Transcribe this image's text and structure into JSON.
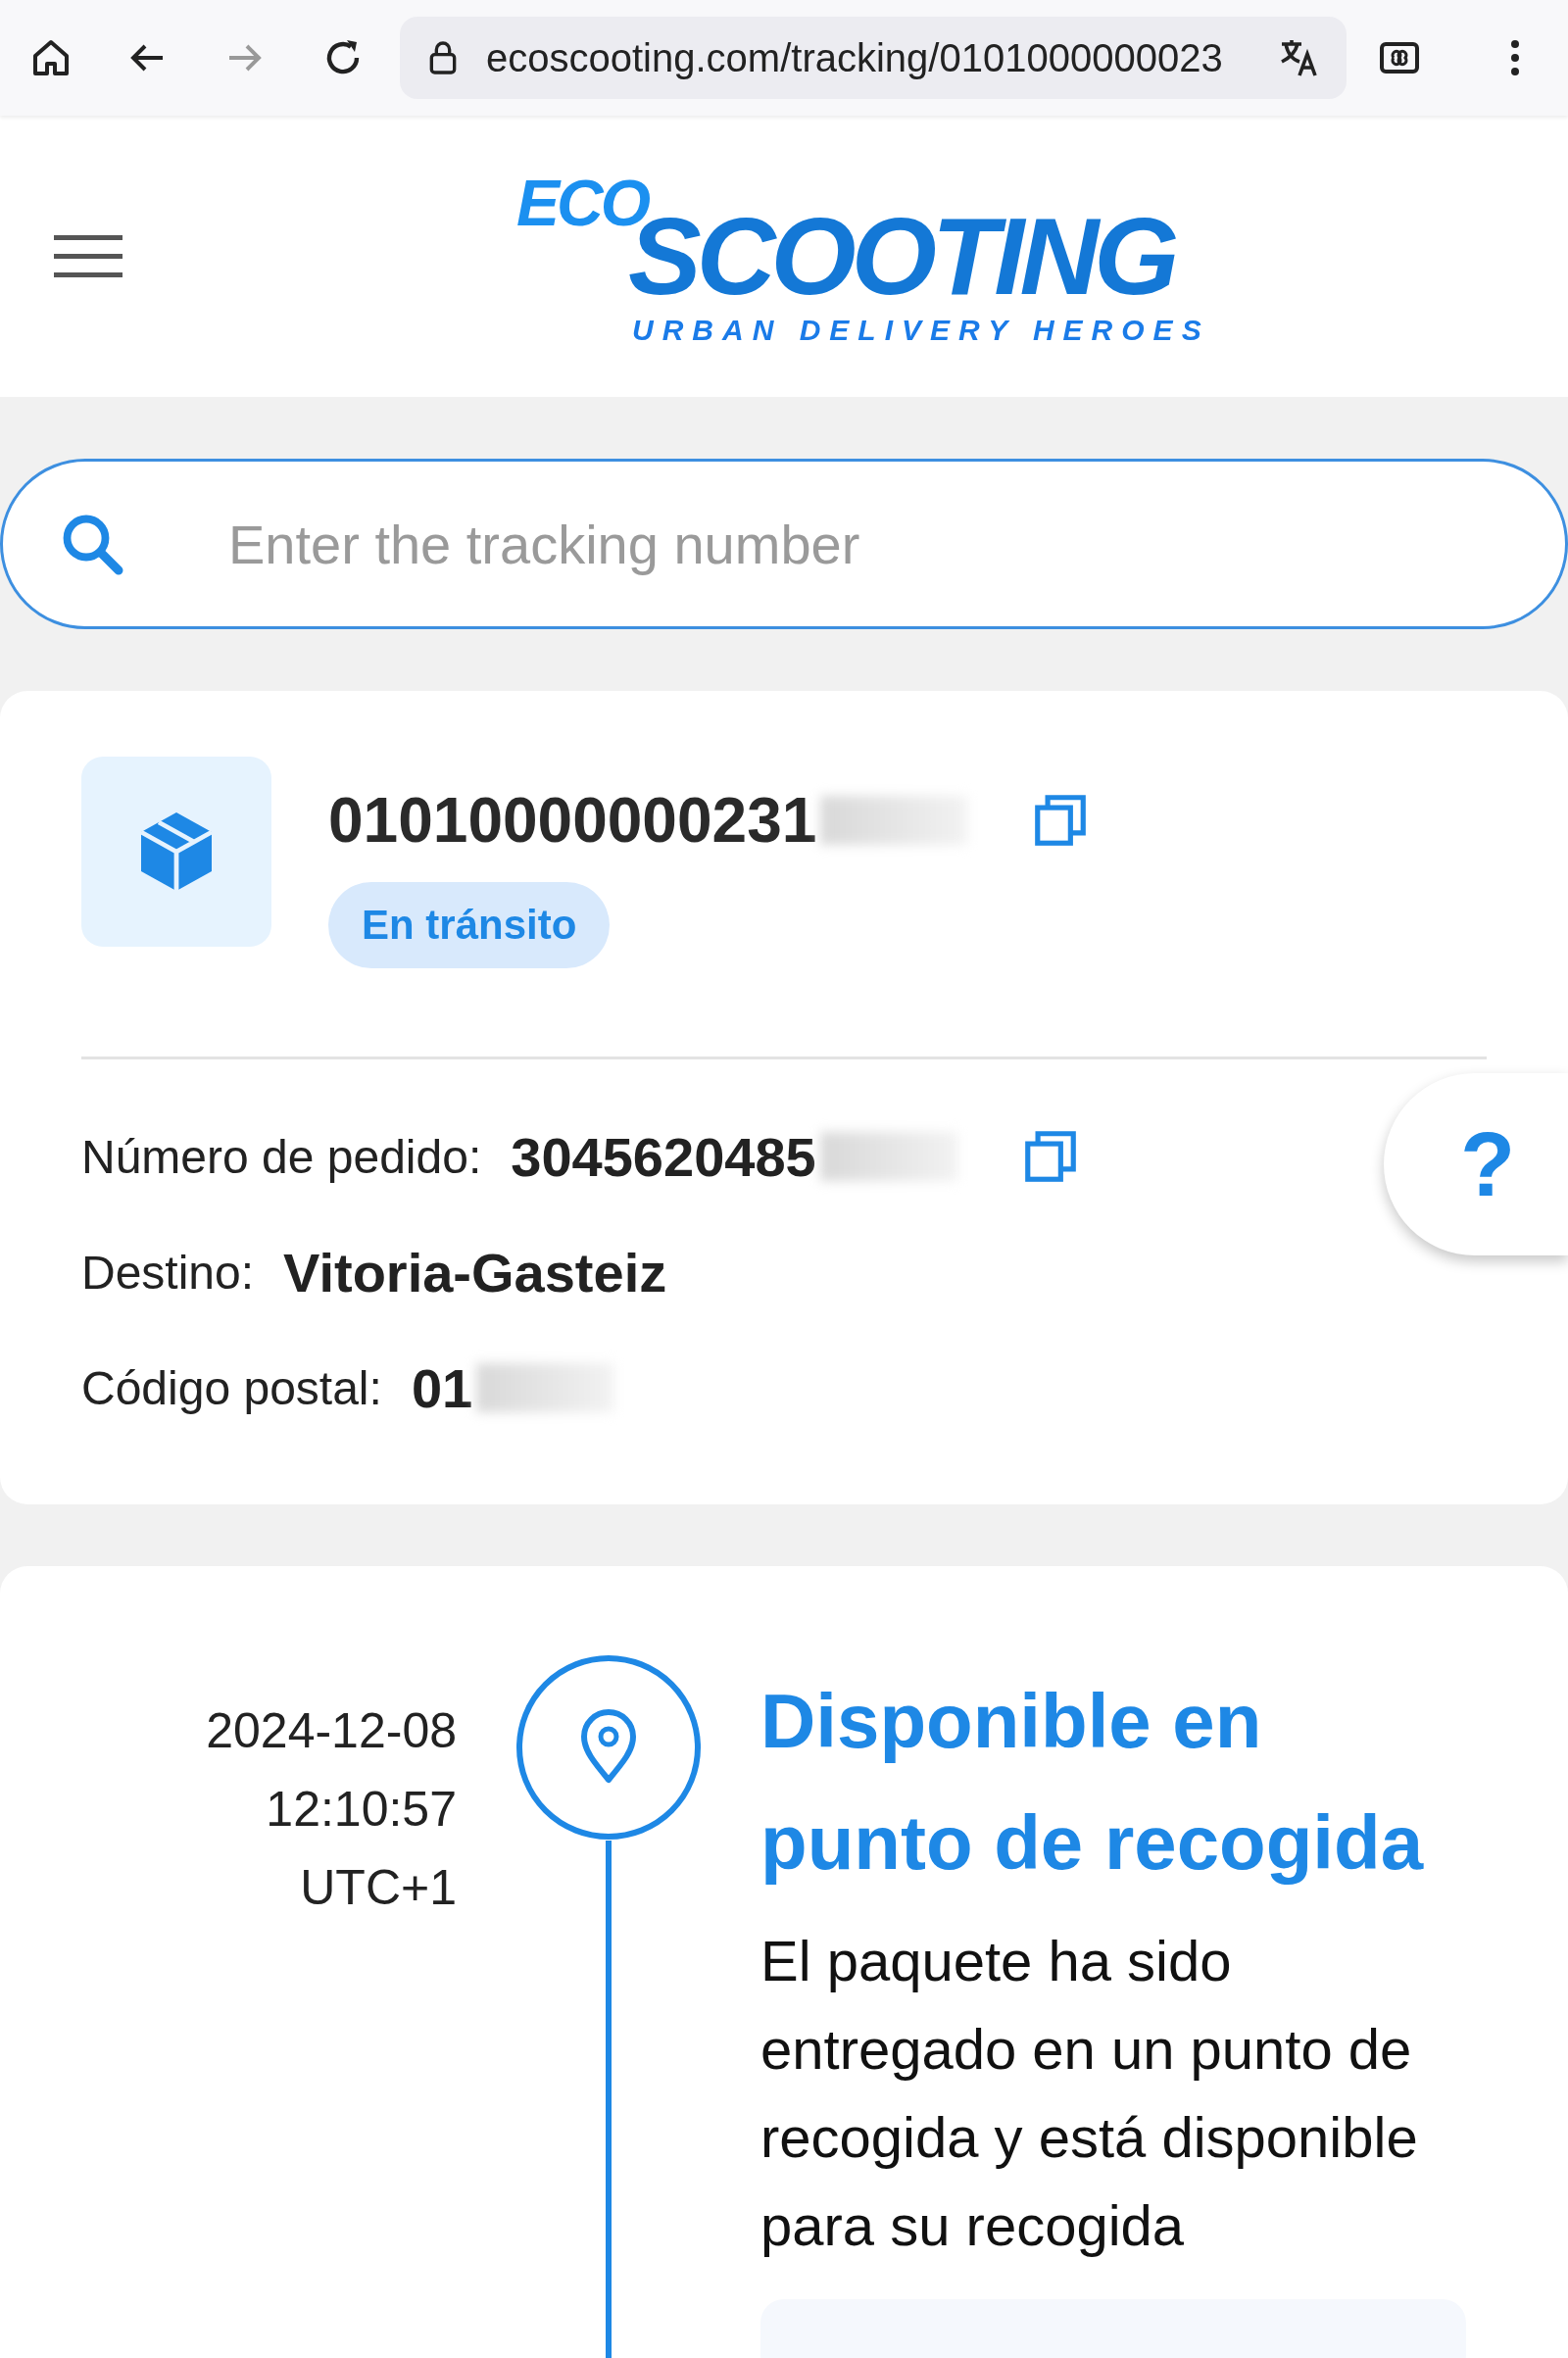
{
  "browser": {
    "url": "ecoscooting.com/tracking/0101000000023"
  },
  "header": {
    "logo_top": "ECO",
    "logo_main": "SCOOTING",
    "logo_tagline": "URBAN DELIVERY HEROES"
  },
  "search": {
    "placeholder": "Enter the tracking number"
  },
  "shipment": {
    "tracking_number": "01010000000231",
    "status": "En tránsito",
    "fields": [
      {
        "label": "Número de pedido:",
        "value": "3045620485",
        "copyable": true
      },
      {
        "label": "Destino:",
        "value": "Vitoria-Gasteiz",
        "copyable": false
      },
      {
        "label": "Código postal:",
        "value": "01",
        "copyable": false
      }
    ]
  },
  "help_button": "?",
  "events": [
    {
      "date": "2024-12-08",
      "time": "12:10:57",
      "zone": "UTC+1",
      "title": "Disponible en punto de recogida",
      "description": "El paquete ha sido entregado en un punto de recogida y está disponible para su recogida"
    }
  ]
}
